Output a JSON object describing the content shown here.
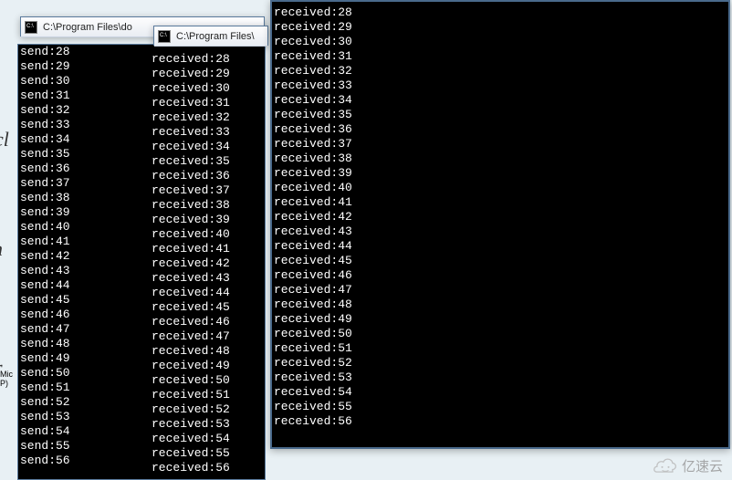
{
  "window_left": {
    "title": "C:\\Program Files\\do",
    "send_start": 28,
    "send_end": 56,
    "recv_start": 28,
    "recv_end": 56,
    "send_prefix": "send:",
    "recv_prefix": "received:"
  },
  "window_left_tab2": {
    "title": "C:\\Program Files\\"
  },
  "window_right": {
    "recv_start": 28,
    "recv_end": 56,
    "recv_prefix": "received:"
  },
  "watermark": {
    "text": "亿速云"
  },
  "desktop": {
    "hint1": "cl",
    "hint2": "n",
    "hint3": "r",
    "icon_text": "Mic\nP)"
  }
}
